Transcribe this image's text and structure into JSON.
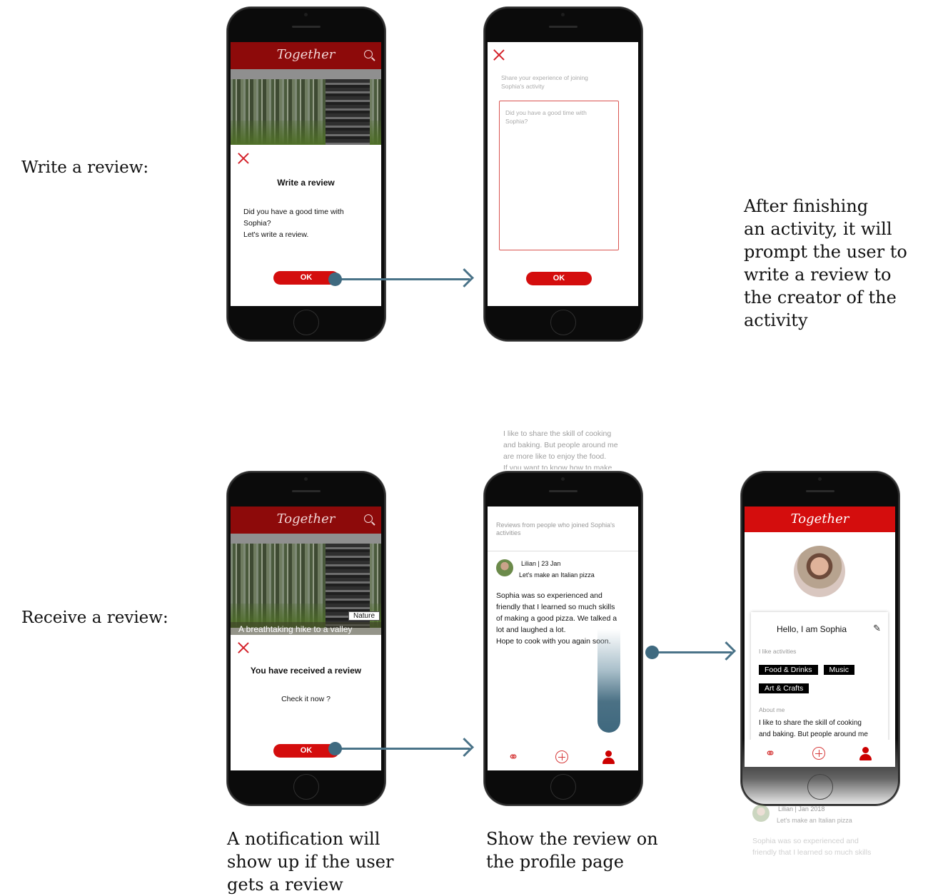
{
  "sections": {
    "write": "Write a review:",
    "receive": "Receive a review:"
  },
  "app": {
    "brand": "Together"
  },
  "phone1": {
    "dialog_title": "Write a review",
    "dialog_body": "Did you have a good time with\nSophia?\nLet's write a review.",
    "ok": "OK"
  },
  "phone2": {
    "prompt": "Share your experience of joining\nSophia's activity",
    "placeholder": "Did you have a good time with\nSophia?",
    "ok": "OK"
  },
  "caption_right": "After finishing\nan activity, it will\nprompt the user to\nwrite a review to\nthe creator of the\nactivity",
  "phone3": {
    "nature_tag": "Nature",
    "card_title": "A breathtaking hike to a valley",
    "dialog_title": "You have received a review",
    "dialog_body": "Check it now ?",
    "ok": "OK"
  },
  "phone4": {
    "bleed_text": "I like to share the skill of cooking\nand baking. But people around me\nare more like to enjoy the food.\nIf you want to know how to make",
    "header": "Reviews from people who joined Sophia's\nactivities",
    "reviewer": "Lilian | 23 Jan",
    "activity": "Let's make an Italian pizza",
    "review": "Sophia was so experienced and\nfriendly that I learned so much skills\nof making a good pizza. We talked a\nlot and laughed a lot.\nHope to cook with you again soon."
  },
  "phone5": {
    "greeting": "Hello, I am Sophia",
    "likes_label": "I like activities",
    "tags": [
      "Food & Drinks",
      "Music",
      "Art & Crafts"
    ],
    "about_label": "About me",
    "about": "I like to share the skill of cooking\nand baking. But people around me",
    "below_reviewer": "Lilian | Jan 2018",
    "below_activity": "Let's make an Italian pizza",
    "below_review": "Sophia was so experienced and\nfriendly that I learned so much skills"
  },
  "caption_left": "A notification will\nshow up if the user\ngets a review",
  "caption_mid": "Show the review on\nthe profile page"
}
